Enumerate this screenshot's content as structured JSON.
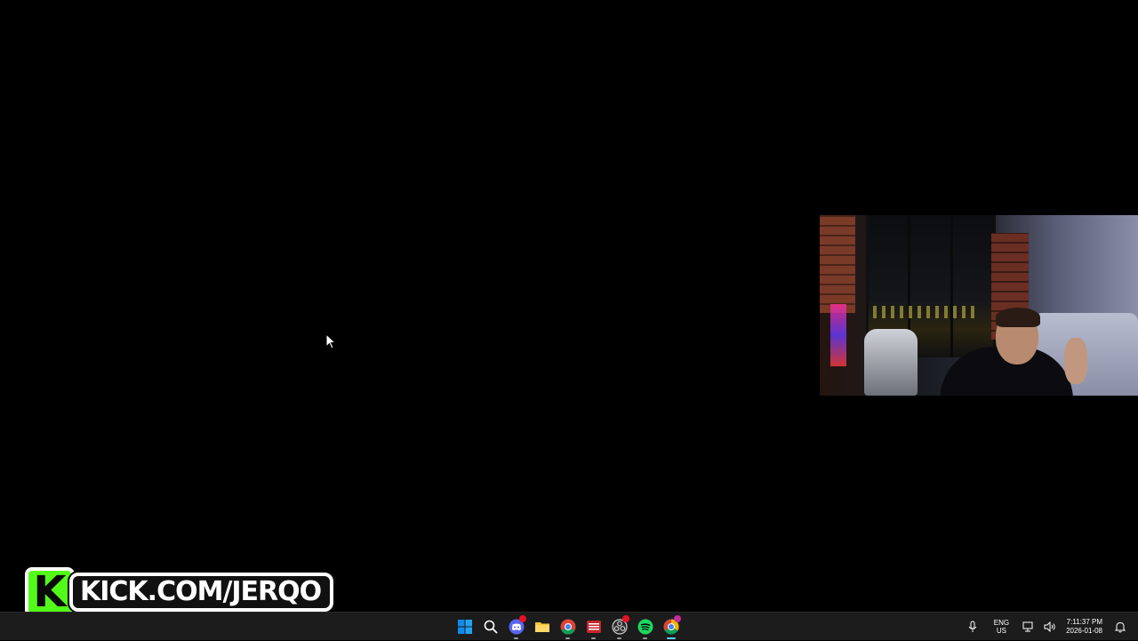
{
  "overlay": {
    "kick_letter": "K",
    "kick_url": "KICK.COM/JERQO",
    "kick_color": "#53fc18"
  },
  "taskbar": {
    "apps": [
      {
        "name": "start-icon",
        "active": false
      },
      {
        "name": "search-icon",
        "active": false
      },
      {
        "name": "discord-icon",
        "active": false,
        "badge": true
      },
      {
        "name": "file-explorer-icon",
        "active": false
      },
      {
        "name": "chrome-icon",
        "active": false
      },
      {
        "name": "stream-deck-icon",
        "active": false
      },
      {
        "name": "obs-icon",
        "active": false,
        "badge": true
      },
      {
        "name": "spotify-icon",
        "active": false
      },
      {
        "name": "chrome-profile-icon",
        "active": true,
        "badge": true
      }
    ],
    "language_line1": "ENG",
    "language_line2": "US",
    "time": "7:11:37 PM",
    "date": "2026-01-08",
    "accent": "#60cdff"
  }
}
